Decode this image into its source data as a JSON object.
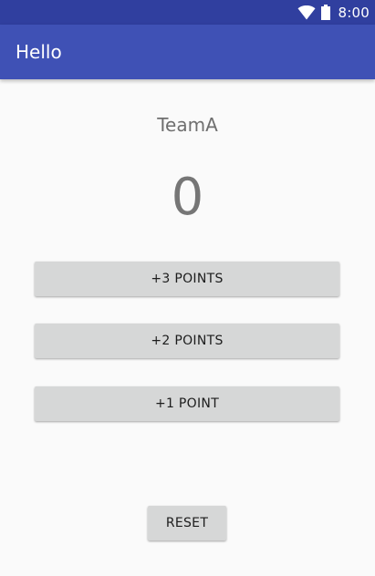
{
  "status_bar": {
    "time": "8:00",
    "icons": [
      "wifi-icon",
      "battery-icon"
    ]
  },
  "app_bar": {
    "title": "Hello"
  },
  "team": {
    "name": "TeamA",
    "score": "0"
  },
  "buttons": {
    "plus_three": "+3 POINTS",
    "plus_two": "+2 POINTS",
    "plus_one": "+1 POINT",
    "reset": "RESET"
  },
  "colors": {
    "status_bar": "#303f9f",
    "app_bar": "#3f51b5",
    "background": "#fafafa",
    "button": "#d6d7d7"
  }
}
